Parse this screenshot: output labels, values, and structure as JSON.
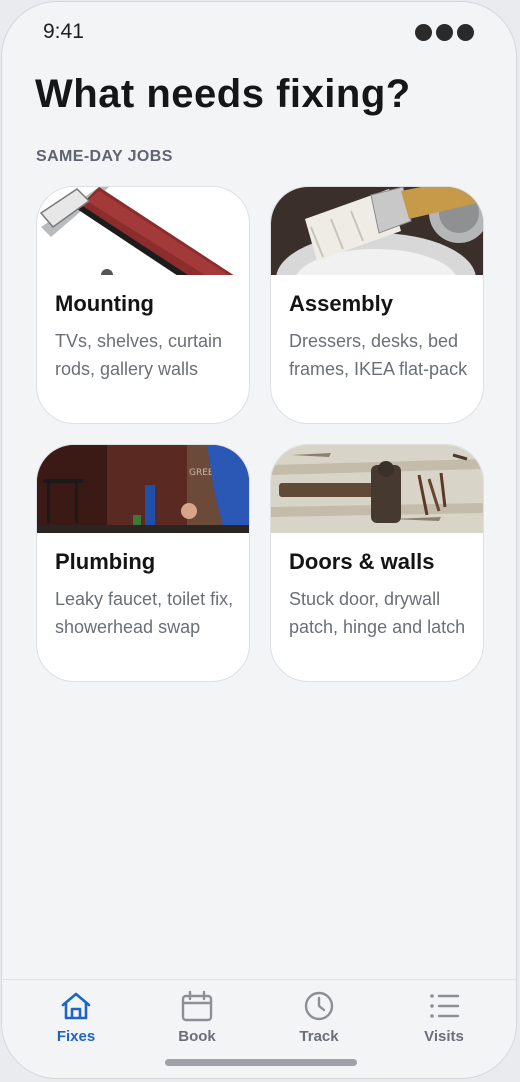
{
  "status": {
    "time": "9:41"
  },
  "page": {
    "title": "What needs fixing?",
    "section_label": "SAME-DAY JOBS"
  },
  "cards": [
    {
      "title": "Mounting",
      "description": "TVs, shelves, curtain rods, gallery walls",
      "image": "hammer-photo"
    },
    {
      "title": "Assembly",
      "description": "Dressers, desks, bed frames, IKEA flat-pack",
      "image": "paint-brush-photo"
    },
    {
      "title": "Plumbing",
      "description": "Leaky faucet, toilet fix, showerhead swap",
      "image": "plumber-photo",
      "image_text": "GREEN St"
    },
    {
      "title": "Doors & walls",
      "description": "Stuck door, drywall patch, hinge and latch",
      "image": "hammer-nails-photo"
    }
  ],
  "tabs": [
    {
      "label": "Fixes",
      "icon": "home-icon",
      "active": true
    },
    {
      "label": "Book",
      "icon": "calendar-icon",
      "active": false
    },
    {
      "label": "Track",
      "icon": "clock-icon",
      "active": false
    },
    {
      "label": "Visits",
      "icon": "list-icon",
      "active": false
    }
  ],
  "colors": {
    "accent": "#1e63c7",
    "background": "#f3f4f6",
    "card": "#ffffff",
    "muted_text": "#6b6f77"
  }
}
